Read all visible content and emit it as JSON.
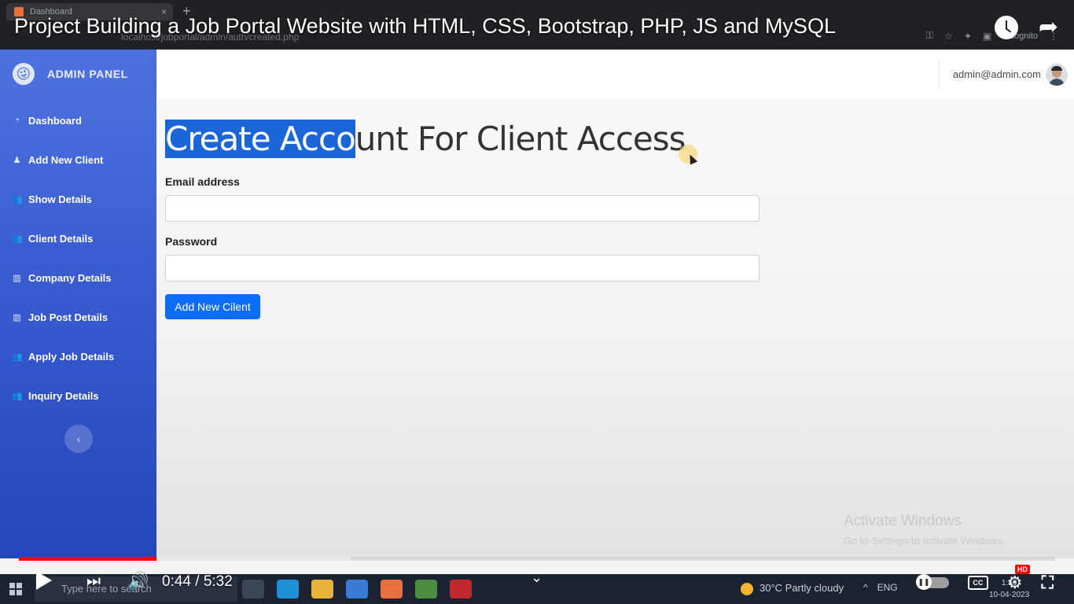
{
  "browser": {
    "tab_title": "Dashboard",
    "tab_close": "×",
    "new_tab": "+",
    "address": "localhost/jobportal/admin/auth/created.php",
    "incognito_label": "Incognito"
  },
  "video": {
    "title": "Project Building a Job Portal Website with HTML, CSS, Bootstrap, PHP, JS and MySQL",
    "time": "0:44 / 5:32",
    "played_fraction": 0.133,
    "buffered_fraction": 0.32,
    "hd_badge": "HD",
    "cc_label": "CC"
  },
  "sidebar": {
    "brand": "ADMIN PANEL",
    "brand_icon": "😜",
    "items": [
      {
        "label": "Dashboard",
        "icon": "◔"
      },
      {
        "label": "Add New Client",
        "icon": "♟"
      },
      {
        "label": "Show Details",
        "icon": "👥"
      },
      {
        "label": "Client Details",
        "icon": "👥"
      },
      {
        "label": "Company Details",
        "icon": "▥"
      },
      {
        "label": "Job Post Details",
        "icon": "▥"
      },
      {
        "label": "Apply Job Details",
        "icon": "👥"
      },
      {
        "label": "Inquiry Details",
        "icon": "👥"
      }
    ],
    "toggle_icon": "‹"
  },
  "topbar": {
    "user_email": "admin@admin.com"
  },
  "main": {
    "title_selected": "Create Acco",
    "title_rest": "unt For Client Access",
    "email_label": "Email address",
    "email_value": "",
    "password_label": "Password",
    "password_value": "",
    "submit_label": "Add New Cilent"
  },
  "watermark": {
    "line1": "Activate Windows",
    "line2": "Go to Settings to activate Windows."
  },
  "taskbar": {
    "search_placeholder": "Type here to search",
    "weather": "30°C  Partly cloudy",
    "language": "ENG",
    "time": "1:50",
    "date": "10-04-2023"
  },
  "colors": {
    "sidebar_top": "#4e73df",
    "sidebar_bottom": "#2447b8",
    "primary_button": "#0d6efd",
    "selection": "#1a66d9",
    "progress": "#ff0000"
  }
}
